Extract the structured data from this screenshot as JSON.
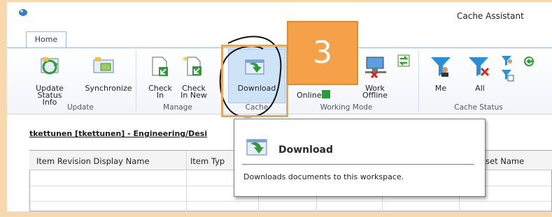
{
  "window": {
    "title": "Cache Assistant"
  },
  "tabs": [
    {
      "label": "Home"
    }
  ],
  "ribbon": {
    "buttons": {
      "update_status_info": "Update Status Info",
      "synchronize": "Synchronize",
      "check_in": "Check In",
      "check_in_new": "Check In New",
      "download": "Download",
      "online": "Online",
      "work_offline": "Work Offline",
      "me": "Me",
      "all": "All"
    },
    "groups": {
      "update": "Update",
      "manage": "Manage",
      "cache": "Cache",
      "working_mode": "Working Mode",
      "cache_status": "Cache Status"
    }
  },
  "breadcrumb": "tkettunen [tkettunen] - Engineering/Desi",
  "table": {
    "columns": [
      "Item Revision Display Name",
      "Item Typ",
      "set Name"
    ]
  },
  "tooltip": {
    "title": "Download",
    "description": "Downloads documents to this workspace."
  },
  "annotation": {
    "step_number": "3"
  },
  "colors": {
    "highlight_orange": "#f5a14a",
    "ribbon_border": "#9eb6d6",
    "selected_button": "#cfe3f6"
  }
}
